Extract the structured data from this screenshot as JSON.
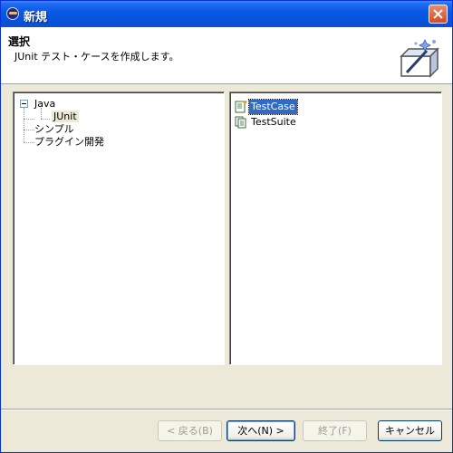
{
  "window": {
    "title": "新規"
  },
  "header": {
    "title": "選択",
    "description": "JUnit テスト・ケースを作成します。"
  },
  "tree": {
    "items": [
      {
        "label": "Java",
        "expanded": true
      },
      {
        "label": "JUnit",
        "selected": true
      },
      {
        "label": "シンプル"
      },
      {
        "label": "プラグイン開発"
      }
    ]
  },
  "list": {
    "items": [
      {
        "label": "TestCase",
        "selected": true,
        "icon": "testcase-icon"
      },
      {
        "label": "TestSuite",
        "icon": "testsuite-icon"
      }
    ]
  },
  "buttons": {
    "back": "< 戻る(B)",
    "next": "次へ(N) >",
    "finish": "終了(F)",
    "cancel": "キャンセル"
  },
  "colors": {
    "titlebar": "#0553DE",
    "selection": "#316AC5",
    "dialog_bg": "#ECE9D8"
  }
}
